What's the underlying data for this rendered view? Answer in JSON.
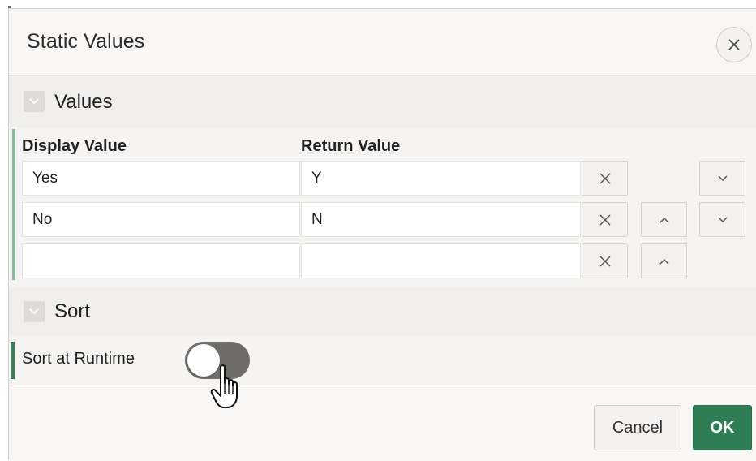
{
  "dialog": {
    "title": "Static Values",
    "close_icon": "close-icon"
  },
  "sections": {
    "values": {
      "title": "Values",
      "toggle_icon": "chevron-down-icon"
    },
    "sort": {
      "title": "Sort",
      "toggle_icon": "chevron-down-icon"
    }
  },
  "table": {
    "headers": {
      "display": "Display Value",
      "return": "Return Value"
    },
    "rows": [
      {
        "display": "Yes",
        "return": "Y"
      },
      {
        "display": "No",
        "return": "N"
      },
      {
        "display": "",
        "return": ""
      }
    ]
  },
  "sort_at_runtime": {
    "label": "Sort at Runtime",
    "enabled": false
  },
  "footer": {
    "cancel_label": "Cancel",
    "ok_label": "OK"
  },
  "colors": {
    "ok_button": "#2f7d55",
    "accent_bar": "#3e7d58",
    "values_accent": "#8db99a",
    "toggle_track": "#6f6d6a"
  }
}
